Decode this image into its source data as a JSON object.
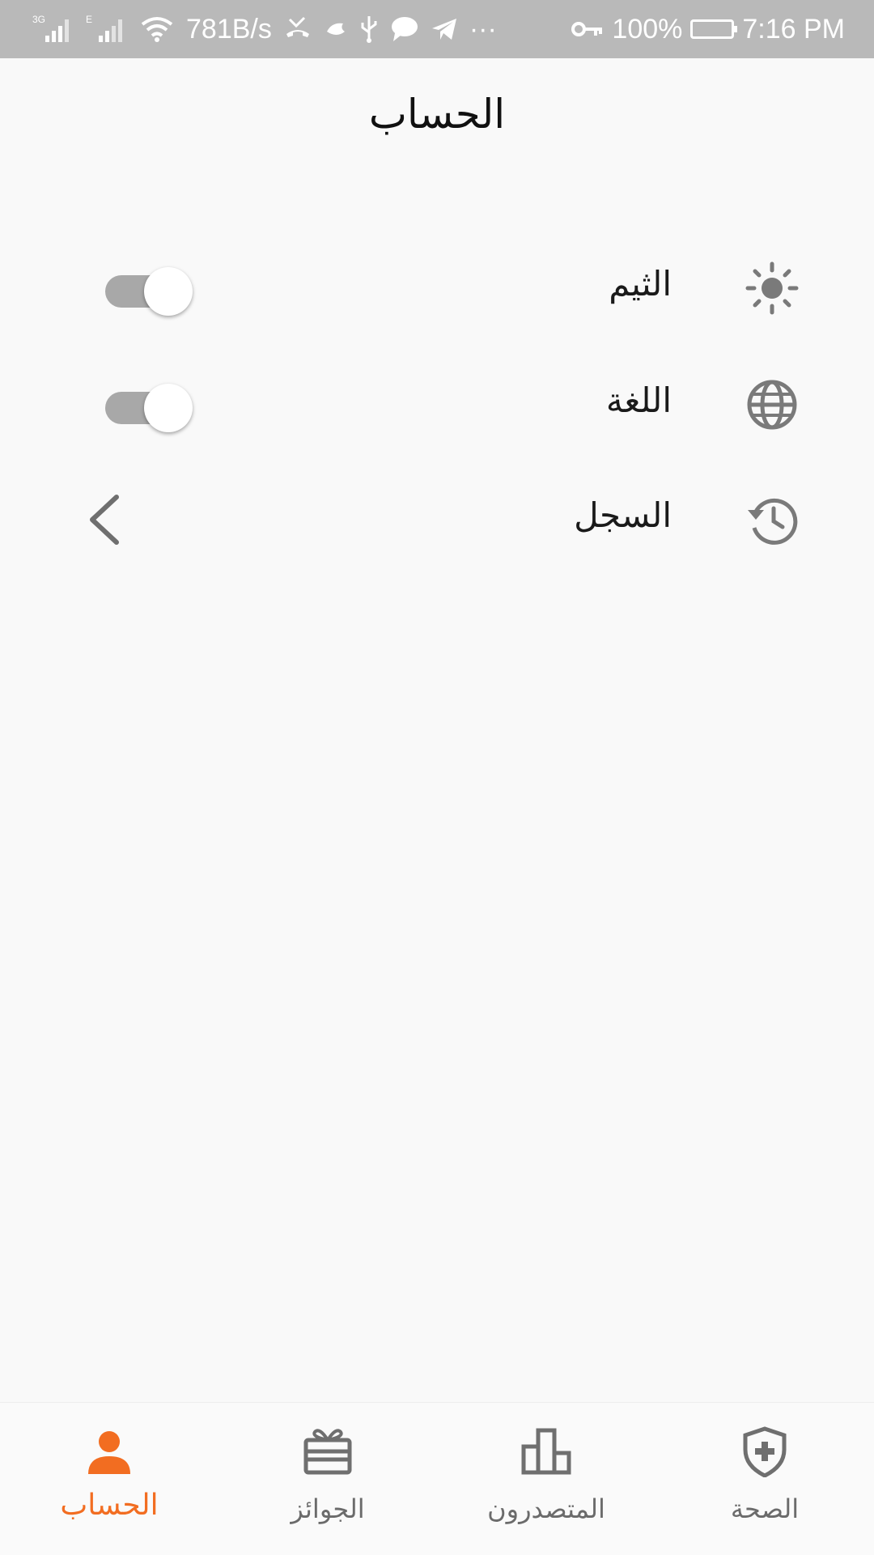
{
  "status_bar": {
    "network_1": "3G",
    "network_2": "E",
    "speed": "781B/s",
    "more": "···",
    "battery": "100%",
    "time": "7:16 PM"
  },
  "page": {
    "title": "الحساب"
  },
  "settings": [
    {
      "label": "الثيم",
      "icon": "sun-icon",
      "control": "toggle",
      "value": "on"
    },
    {
      "label": "اللغة",
      "icon": "globe-icon",
      "control": "toggle",
      "value": "on"
    },
    {
      "label": "السجل",
      "icon": "history-icon",
      "control": "chevron"
    }
  ],
  "bottom_nav": {
    "items": [
      {
        "label": "الحساب",
        "icon": "person-icon",
        "active": true
      },
      {
        "label": "الجوائز",
        "icon": "gift-icon",
        "active": false
      },
      {
        "label": "المتصدرون",
        "icon": "leaderboard-icon",
        "active": false
      },
      {
        "label": "الصحة",
        "icon": "shield-plus-icon",
        "active": false
      }
    ]
  },
  "colors": {
    "accent": "#f26d21",
    "icon_gray": "#7a7a7a",
    "status_bar_bg": "#b9b9b9",
    "toggle_track": "#a8a8a8"
  }
}
